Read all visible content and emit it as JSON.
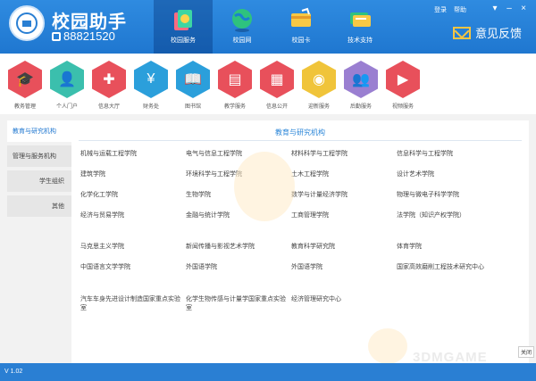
{
  "header": {
    "app_title": "校园助手",
    "phone": "88821520",
    "links": [
      "登录",
      "帮助"
    ],
    "feedback": "意见反馈"
  },
  "nav": [
    {
      "label": "校园服务",
      "active": true,
      "icon": "school-services-icon"
    },
    {
      "label": "校园网",
      "active": false,
      "icon": "globe-icon"
    },
    {
      "label": "校园卡",
      "active": false,
      "icon": "campus-card-icon"
    },
    {
      "label": "技术支持",
      "active": false,
      "icon": "tech-support-icon"
    }
  ],
  "tiles": [
    {
      "label": "教务管理",
      "color": "#e8505b",
      "icon": "graduation-cap-icon"
    },
    {
      "label": "个人门户",
      "color": "#3bbfad",
      "icon": "person-icon"
    },
    {
      "label": "信息大厅",
      "color": "#e8505b",
      "icon": "puzzle-icon"
    },
    {
      "label": "财务处",
      "color": "#2b9fdb",
      "icon": "money-bag-icon"
    },
    {
      "label": "图书馆",
      "color": "#2b9fdb",
      "icon": "book-icon"
    },
    {
      "label": "教学服务",
      "color": "#e8505b",
      "icon": "presentation-icon"
    },
    {
      "label": "信息公开",
      "color": "#e8505b",
      "icon": "news-icon"
    },
    {
      "label": "迎新服务",
      "color": "#f0c43a",
      "icon": "disc-icon"
    },
    {
      "label": "后勤服务",
      "color": "#9a7fd1",
      "icon": "people-icon"
    },
    {
      "label": "视频服务",
      "color": "#e8505b",
      "icon": "video-icon"
    }
  ],
  "sidebar": [
    {
      "label": "教育与研究机构",
      "selected": true,
      "align": "left"
    },
    {
      "label": "管理与服务机构",
      "selected": false,
      "align": "left"
    },
    {
      "label": "学生组织",
      "selected": false,
      "align": "right"
    },
    {
      "label": "其他",
      "selected": false,
      "align": "right"
    }
  ],
  "content": {
    "title": "教育与研究机构",
    "rows": [
      [
        "机械与运载工程学院",
        "电气与信息工程学院",
        "材料科学与工程学院",
        "信息科学与工程学院"
      ],
      [
        "建筑学院",
        "环境科学与工程学院",
        "土木工程学院",
        "设计艺术学院"
      ],
      [
        "化学化工学院",
        "生物学院",
        "数学与计量经济学院",
        "物理与微电子科学学院"
      ],
      [
        "经济与贸易学院",
        "金融与统计学院",
        "工商管理学院",
        "法学院（知识产权学院）"
      ],
      [
        "马克思主义学院",
        "新闻传播与影视艺术学院",
        "教育科学研究院",
        "体育学院"
      ],
      [
        "中国语言文学学院",
        "外国语学院",
        "外国语学院",
        "国家高效磨削工程技术研究中心"
      ],
      [
        "汽车车身先进设计制造国家重点实验室",
        "化学生物传感与计量学国家重点实验室",
        "经济管理研究中心",
        ""
      ]
    ]
  },
  "status": {
    "version": "V 1.02",
    "tip": "关闭"
  },
  "watermark": "3DMGAME"
}
